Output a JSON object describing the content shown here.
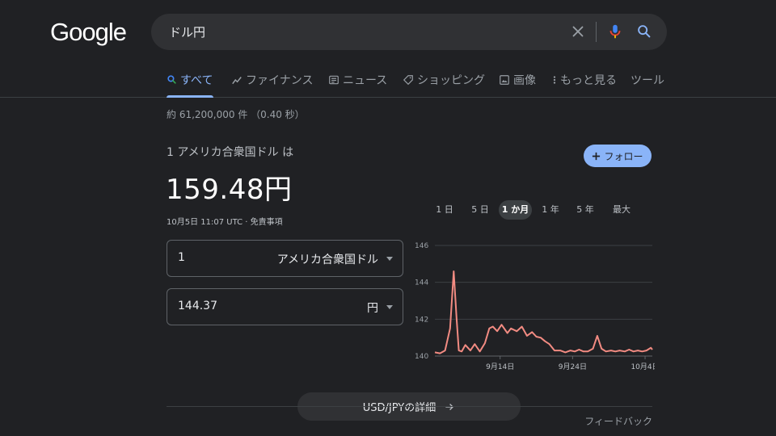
{
  "logo": "Google",
  "search": {
    "query": "ドル円"
  },
  "tabs": [
    {
      "label": "すべて",
      "icon": "search-icon",
      "active": true
    },
    {
      "label": "ファイナンス",
      "icon": "finance-icon",
      "active": false
    },
    {
      "label": "ニュース",
      "icon": "news-icon",
      "active": false
    },
    {
      "label": "ショッピング",
      "icon": "tag-icon",
      "active": false
    },
    {
      "label": "画像",
      "icon": "image-icon",
      "active": false
    },
    {
      "label": "もっと見る",
      "icon": "more-vert-icon",
      "active": false
    },
    {
      "label": "ツール",
      "active": false
    }
  ],
  "result_stats": "約 61,200,000 件 （0.40 秒）",
  "converter": {
    "label": "1 アメリカ合衆国ドル は",
    "value": "159.48円",
    "meta": "10月5日 11:07 UTC · 免責事項",
    "follow_label": "フォロー",
    "from": {
      "amount": "1",
      "currency": "アメリカ合衆国ドル"
    },
    "to": {
      "amount": "144.37",
      "currency": "円"
    }
  },
  "ranges": [
    {
      "label": "1 日",
      "active": false
    },
    {
      "label": "5 日",
      "active": false
    },
    {
      "label": "1 か月",
      "active": true
    },
    {
      "label": "1 年",
      "active": false
    },
    {
      "label": "5 年",
      "active": false
    },
    {
      "label": "最大",
      "active": false
    }
  ],
  "details_label": "USD/JPYの詳細",
  "feedback_label": "フィードバック",
  "colors": {
    "accent": "#8ab4f8",
    "line": "#f28b82",
    "background": "#202124"
  },
  "chart_data": {
    "type": "line",
    "title": "",
    "xlabel": "",
    "ylabel": "",
    "ylim": [
      140,
      146
    ],
    "yticks": [
      146,
      144,
      142,
      140
    ],
    "xtick_labels": [
      "9月14日",
      "9月24日",
      "10月4日"
    ],
    "xtick_positions": [
      9,
      19,
      29
    ],
    "grid": true,
    "series": [
      {
        "x": [
          0,
          0.7,
          1.4,
          2.1,
          2.6,
          3.0,
          3.3,
          3.7,
          4.2,
          4.9,
          5.5,
          6.2,
          6.9,
          7.5,
          8.0,
          8.6,
          9.2,
          10.0,
          10.5,
          11.3,
          12.0,
          12.7,
          13.4,
          14.0,
          14.6,
          15.2,
          15.8,
          16.5,
          17.3,
          18.0,
          18.7,
          19.3,
          19.9,
          20.5,
          21.1,
          21.8,
          22.4,
          23.0,
          23.6,
          24.3,
          24.9,
          25.5,
          26.2,
          26.8,
          27.4,
          28.0,
          28.6,
          29.2,
          29.8,
          30.0
        ],
        "values": [
          140.2,
          140.15,
          140.3,
          141.5,
          144.6,
          142.0,
          140.3,
          140.25,
          140.6,
          140.3,
          140.65,
          140.25,
          140.7,
          141.5,
          141.6,
          141.35,
          141.7,
          141.25,
          141.5,
          141.35,
          141.6,
          141.1,
          141.3,
          141.05,
          141.0,
          140.8,
          140.65,
          140.3,
          140.3,
          140.2,
          140.3,
          140.25,
          140.35,
          140.25,
          140.25,
          140.4,
          141.1,
          140.4,
          140.25,
          140.3,
          140.25,
          140.3,
          140.25,
          140.35,
          140.25,
          140.3,
          140.25,
          140.3,
          140.45,
          140.35
        ]
      }
    ]
  }
}
